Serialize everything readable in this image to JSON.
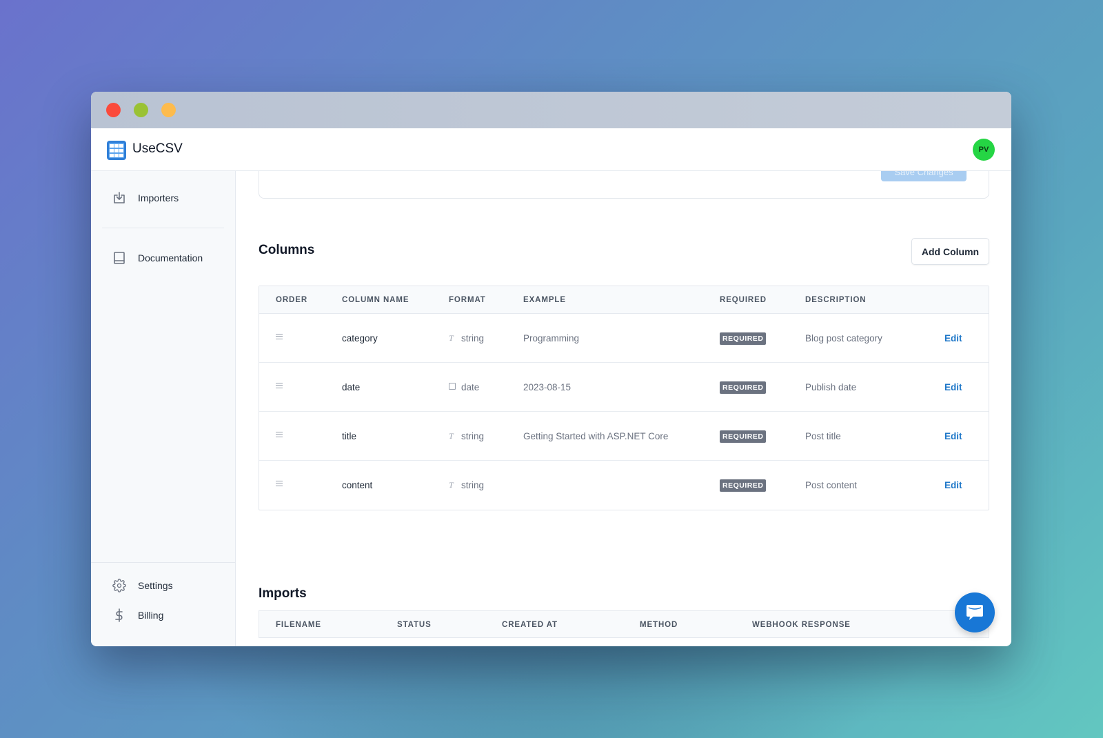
{
  "app": {
    "name": "UseCSV",
    "user_initials": "PV"
  },
  "sidebar": {
    "items": [
      {
        "label": "Importers",
        "icon": "import-icon"
      },
      {
        "label": "Documentation",
        "icon": "book-icon"
      }
    ],
    "bottom_items": [
      {
        "label": "Settings",
        "icon": "gear-icon"
      },
      {
        "label": "Billing",
        "icon": "dollar-icon"
      }
    ]
  },
  "top_card": {
    "save_label": "Save Changes"
  },
  "columns_section": {
    "title": "Columns",
    "add_button": "Add Column",
    "headers": [
      "ORDER",
      "COLUMN NAME",
      "FORMAT",
      "EXAMPLE",
      "REQUIRED",
      "DESCRIPTION"
    ],
    "rows": [
      {
        "name": "category",
        "format": "string",
        "format_icon": "text-format-icon",
        "example": "Programming",
        "required": "REQUIRED",
        "description": "Blog post category",
        "action": "Edit"
      },
      {
        "name": "date",
        "format": "date",
        "format_icon": "calendar-icon",
        "example": "2023-08-15",
        "required": "REQUIRED",
        "description": "Publish date",
        "action": "Edit"
      },
      {
        "name": "title",
        "format": "string",
        "format_icon": "text-format-icon",
        "example": "Getting Started with ASP.NET Core",
        "required": "REQUIRED",
        "description": "Post title",
        "action": "Edit"
      },
      {
        "name": "content",
        "format": "string",
        "format_icon": "text-format-icon",
        "example": "",
        "required": "REQUIRED",
        "description": "Post content",
        "action": "Edit"
      }
    ]
  },
  "imports_section": {
    "title": "Imports",
    "headers": [
      "FILENAME",
      "STATUS",
      "CREATED AT",
      "METHOD",
      "WEBHOOK RESPONSE"
    ]
  },
  "colors": {
    "accent": "#1e77c8",
    "avatar": "#25d544",
    "chat": "#1877d6",
    "badge": "#6b7280"
  }
}
